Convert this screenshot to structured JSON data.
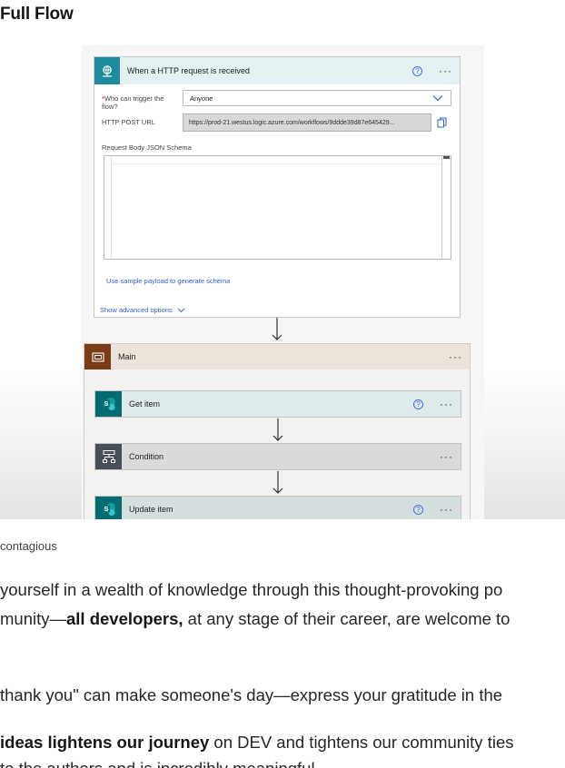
{
  "article": {
    "heading": "Full Flow",
    "caption": "contagious",
    "paragraphs": [
      {
        "text": "yourself in a wealth of knowledge through this thought-provoking po"
      },
      {
        "pre": "munity—",
        "bold": "all developers,",
        "post": " at any stage of their career, are welcome to"
      },
      {
        "text": "thank you\" can make someone's day—express your gratitude in the"
      },
      {
        "bold": "ideas lightens our journey",
        "post": " on DEV and tightens our community ties"
      },
      {
        "text": "to the authors and is incredibly meaningful"
      }
    ]
  },
  "flow": {
    "trigger": {
      "title": "When a HTTP request is received",
      "help": "?",
      "more": "···",
      "who_label_required": "*",
      "who_label": "Who can trigger the flow?",
      "who_value": "Anyone",
      "url_label": "HTTP POST URL",
      "url_value": "https://prod-21.westus.logic.azure.com/workflows/9ddde39d87e645429...",
      "schema_label": "Request Body JSON Schema",
      "sample_link": "Use sample payload to generate schema",
      "advanced_link": "Show advanced options"
    },
    "scope": {
      "title": "Main",
      "more": "···"
    },
    "actions": [
      {
        "title": "Get item",
        "help": "?",
        "more": "···"
      },
      {
        "title": "Condition",
        "more": "···"
      },
      {
        "title": "Update item",
        "help": "?",
        "more": "···"
      }
    ]
  },
  "colors": {
    "trigger_header": "#e3f1f2",
    "scope_header": "#ece3da",
    "scope_icon": "#7a3c18",
    "sharepoint_icon": "#036c70",
    "condition_icon": "#484f58",
    "link": "#2f62c8"
  },
  "icons": {
    "trigger": "http-request-icon",
    "scope": "scope-icon",
    "get_item": "sharepoint-icon",
    "condition": "condition-icon",
    "update_item": "sharepoint-icon",
    "dropdown": "chevron-down-icon",
    "copy": "copy-icon",
    "connector": "arrow-down-icon"
  }
}
